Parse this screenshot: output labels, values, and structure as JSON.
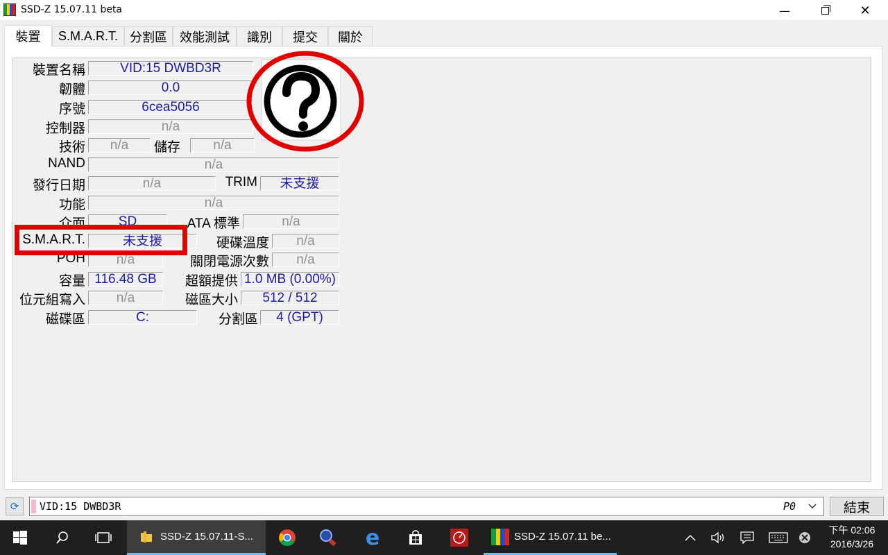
{
  "window": {
    "title": "SSD-Z 15.07.11 beta"
  },
  "tabs": [
    "裝置",
    "S.M.A.R.T.",
    "分割區",
    "效能測試",
    "識別",
    "提交",
    "關於"
  ],
  "device": {
    "labels": {
      "name": "裝置名稱",
      "firmware": "韌體",
      "serial": "序號",
      "controller": "控制器",
      "technology": "技術",
      "storage": "儲存",
      "nand": "NAND",
      "release_date": "發行日期",
      "trim": "TRIM",
      "features": "功能",
      "interface": "介面",
      "ata_standard": "ATA 標準",
      "smart": "S.M.A.R.T.",
      "temperature": "硬碟溫度",
      "poh": "POH",
      "power_cycles": "關閉電源次數",
      "capacity": "容量",
      "overprovision": "超額提供",
      "bytes_written": "位元組寫入",
      "sector_size": "磁區大小",
      "volumes": "磁碟區",
      "partitions": "分割區"
    },
    "values": {
      "name": "VID:15 DWBD3R",
      "firmware": "0.0",
      "serial": "6cea5056",
      "controller": "n/a",
      "technology": "n/a",
      "storage": "n/a",
      "nand": "n/a",
      "release_date": "n/a",
      "trim": "未支援",
      "features": "n/a",
      "interface": "SD",
      "ata_standard": "n/a",
      "smart": "未支援",
      "temperature": "n/a",
      "poh": "n/a",
      "power_cycles": "n/a",
      "capacity": "116.48 GB",
      "overprovision": "1.0 MB (0.00%)",
      "bytes_written": "n/a",
      "sector_size": "512 / 512",
      "volumes": "C:",
      "partitions": "4 (GPT)"
    }
  },
  "statusbar": {
    "drive_label": "VID:15 DWBD3R",
    "drive_port": "P0",
    "exit_label": "結束"
  },
  "taskbar": {
    "explorer_label": "SSD-Z 15.07.11-S...",
    "ssdz_label": "SSD-Z 15.07.11 be...",
    "clock_time": "下午 02:06",
    "clock_date": "2016/3/26"
  }
}
